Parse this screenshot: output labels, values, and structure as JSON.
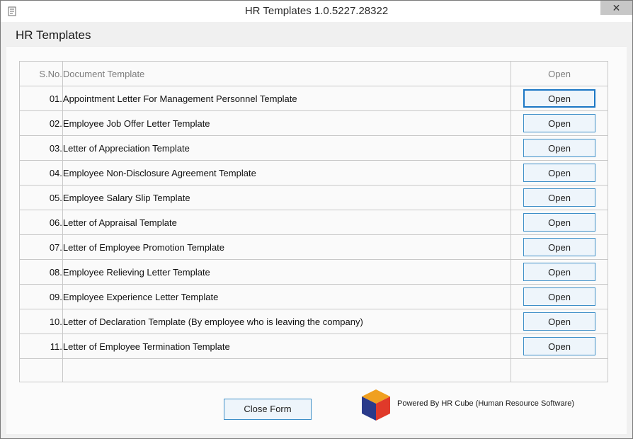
{
  "window": {
    "title": "HR Templates 1.0.5227.28322",
    "close_label": "✕"
  },
  "header": {
    "title": "HR Templates"
  },
  "table": {
    "columns": {
      "sno": "S.No.",
      "document": "Document Template",
      "open": "Open"
    },
    "rows": [
      {
        "sno": "01.",
        "document": "Appointment Letter For Management Personnel Template",
        "action": "Open"
      },
      {
        "sno": "02.",
        "document": "Employee Job Offer Letter Template",
        "action": "Open"
      },
      {
        "sno": "03.",
        "document": "Letter of Appreciation Template",
        "action": "Open"
      },
      {
        "sno": "04.",
        "document": "Employee Non-Disclosure Agreement Template",
        "action": "Open"
      },
      {
        "sno": "05.",
        "document": "Employee Salary Slip Template",
        "action": "Open"
      },
      {
        "sno": "06.",
        "document": "Letter of Appraisal Template",
        "action": "Open"
      },
      {
        "sno": "07.",
        "document": "Letter of Employee Promotion Template",
        "action": "Open"
      },
      {
        "sno": "08.",
        "document": "Employee Relieving Letter Template",
        "action": "Open"
      },
      {
        "sno": "09.",
        "document": "Employee Experience Letter Template",
        "action": "Open"
      },
      {
        "sno": "10.",
        "document": "Letter of Declaration Template (By employee who is leaving the company)",
        "action": "Open"
      },
      {
        "sno": "11.",
        "document": "Letter of Employee Termination Template",
        "action": "Open"
      }
    ]
  },
  "footer": {
    "close_form_label": "Close Form",
    "powered_by": "Powered By HR Cube (Human Resource Software)"
  },
  "colors": {
    "button_border": "#3e8fc8",
    "button_bg": "#eef5fb",
    "logo_top": "#f0a020",
    "logo_left": "#2a3a8a",
    "logo_right": "#e03a2a"
  }
}
